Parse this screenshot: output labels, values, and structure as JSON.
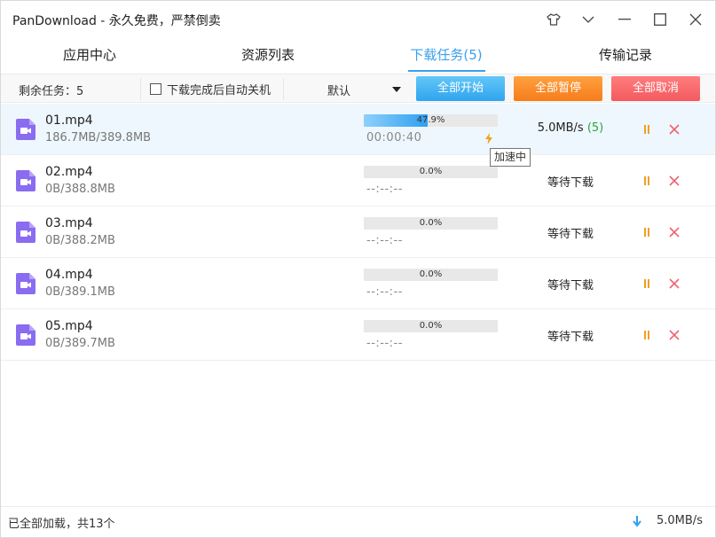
{
  "window": {
    "title": "PanDownload - 永久免费，严禁倒卖",
    "controls": [
      {
        "name": "skin-icon"
      },
      {
        "name": "dropdown-icon"
      },
      {
        "name": "minimize-icon"
      },
      {
        "name": "maximize-icon"
      },
      {
        "name": "close-icon"
      }
    ]
  },
  "tabs": [
    {
      "label": "应用中心",
      "active": false
    },
    {
      "label": "资源列表",
      "active": false
    },
    {
      "label": "下载任务(5)",
      "active": true
    },
    {
      "label": "传输记录",
      "active": false
    }
  ],
  "toolbar": {
    "remaining_label": "剩余任务：5",
    "auto_shutdown_label": "下载完成后自动关机",
    "auto_shutdown_checked": false,
    "mode_select_value": "默认",
    "start_all_label": "全部开始",
    "pause_all_label": "全部暂停",
    "cancel_all_label": "全部取消"
  },
  "tasks": [
    {
      "name": "01.mp4",
      "size": "186.7MB/389.8MB",
      "progress": 0.479,
      "progress_label": "47.9%",
      "time": "00:00:40",
      "status": "5.0MB/s",
      "status_count": "(5)",
      "accelerated": true,
      "selected": true
    },
    {
      "name": "02.mp4",
      "size": "0B/388.8MB",
      "progress": 0,
      "progress_label": "0.0%",
      "time": "--:--:--",
      "status": "等待下载",
      "status_count": "",
      "accelerated": false,
      "selected": false
    },
    {
      "name": "03.mp4",
      "size": "0B/388.2MB",
      "progress": 0,
      "progress_label": "0.0%",
      "time": "--:--:--",
      "status": "等待下载",
      "status_count": "",
      "accelerated": false,
      "selected": false
    },
    {
      "name": "04.mp4",
      "size": "0B/389.1MB",
      "progress": 0,
      "progress_label": "0.0%",
      "time": "--:--:--",
      "status": "等待下载",
      "status_count": "",
      "accelerated": false,
      "selected": false
    },
    {
      "name": "05.mp4",
      "size": "0B/389.7MB",
      "progress": 0,
      "progress_label": "0.0%",
      "time": "--:--:--",
      "status": "等待下载",
      "status_count": "",
      "accelerated": false,
      "selected": false
    }
  ],
  "tooltip": "加速中",
  "statusbar": {
    "loaded_text": "已全部加载，共13个",
    "total_speed": "5.0MB/s"
  },
  "colors": {
    "accent": "#3aa0ec",
    "start_button": "#2fa4ee",
    "pause_button": "#f67c1c",
    "cancel_button": "#f35a5f",
    "file_icon": "#8a6cf0",
    "pause_icon": "#f0a020",
    "delete_icon": "#f06070",
    "speed_count": "#2aa63a"
  }
}
